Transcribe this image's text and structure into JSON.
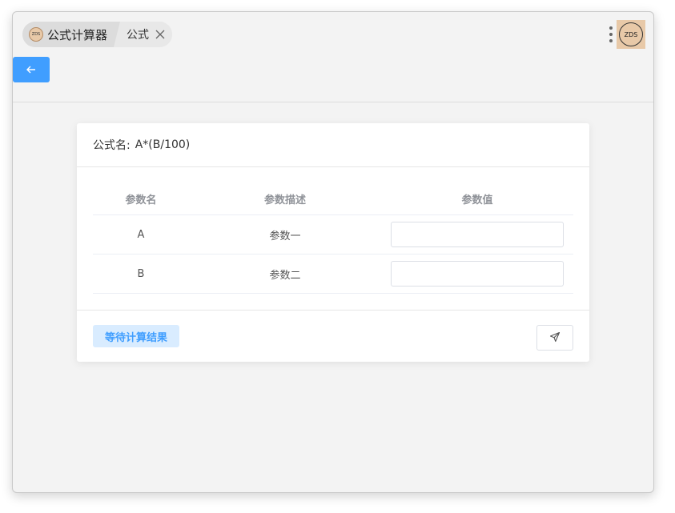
{
  "tabs": {
    "app": {
      "label": "公式计算器",
      "logo_text": "ZDS"
    },
    "current": {
      "label": "公式"
    }
  },
  "avatar": {
    "text": "ZDS",
    "bg_color": "#e8c9a8"
  },
  "back_button": {
    "icon": "arrow-left-icon",
    "color": "#409eff"
  },
  "formula": {
    "label": "公式名:",
    "value": "A*(B/100)"
  },
  "table": {
    "headers": {
      "name": "参数名",
      "description": "参数描述",
      "value": "参数值"
    },
    "rows": [
      {
        "name": "A",
        "description": "参数一",
        "value": ""
      },
      {
        "name": "B",
        "description": "参数二",
        "value": ""
      }
    ]
  },
  "result": {
    "status_text": "等待计算结果"
  },
  "send_button": {
    "icon": "send-icon"
  }
}
